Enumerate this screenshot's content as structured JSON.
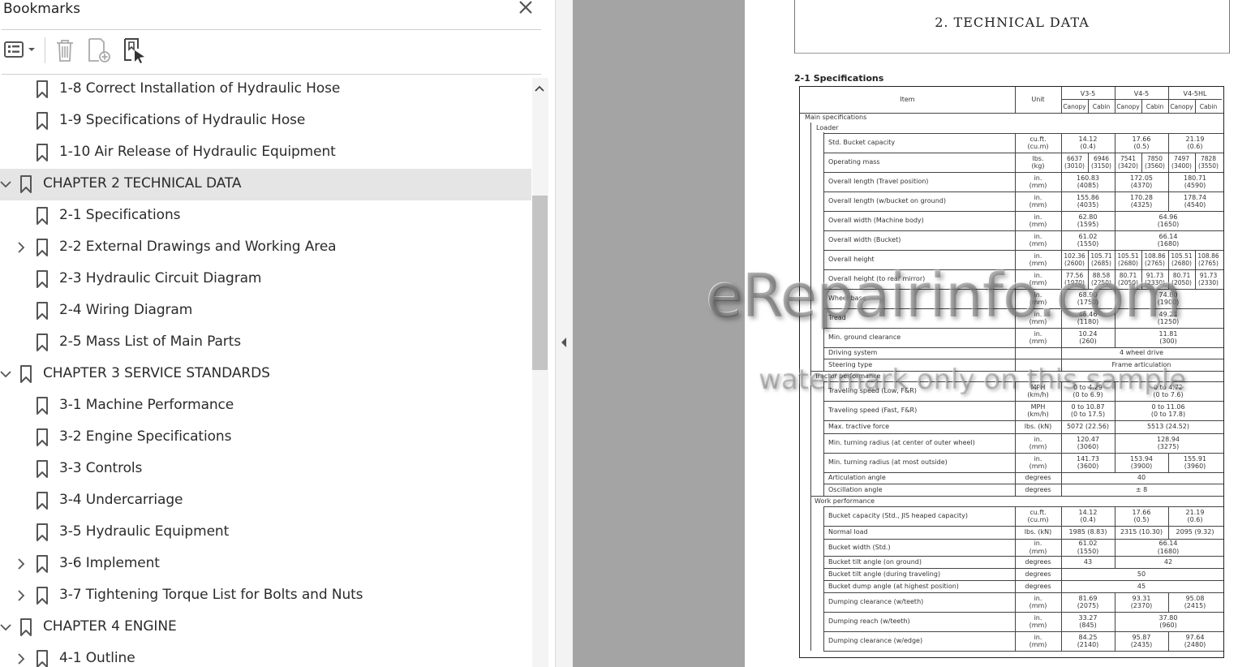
{
  "panel": {
    "title": "Bookmarks",
    "toolbar": {
      "options_icon": "list-options-icon",
      "delete_icon": "trash-icon",
      "new_bookmark_icon": "add-bookmark-icon",
      "find_bookmark_icon": "find-current-bookmark-icon"
    },
    "items": [
      {
        "label": "1-8 Correct Installation of Hydraulic Hose",
        "level": 2,
        "expander": "none",
        "selected": false
      },
      {
        "label": "1-9 Specifications of Hydraulic Hose",
        "level": 2,
        "expander": "none",
        "selected": false
      },
      {
        "label": "1-10 Air Release of Hydraulic Equipment",
        "level": 2,
        "expander": "none",
        "selected": false
      },
      {
        "label": "CHAPTER 2 TECHNICAL DATA",
        "level": 1,
        "expander": "expanded",
        "selected": true
      },
      {
        "label": "2-1 Specifications",
        "level": 2,
        "expander": "none",
        "selected": false
      },
      {
        "label": "2-2 External Drawings and Working Area",
        "level": 2,
        "expander": "collapsed",
        "selected": false
      },
      {
        "label": "2-3 Hydraulic Circuit Diagram",
        "level": 2,
        "expander": "none",
        "selected": false
      },
      {
        "label": "2-4 Wiring Diagram",
        "level": 2,
        "expander": "none",
        "selected": false
      },
      {
        "label": "2-5 Mass List of Main Parts",
        "level": 2,
        "expander": "none",
        "selected": false
      },
      {
        "label": "CHAPTER 3 SERVICE STANDARDS",
        "level": 1,
        "expander": "expanded",
        "selected": false
      },
      {
        "label": "3-1 Machine Performance",
        "level": 2,
        "expander": "none",
        "selected": false
      },
      {
        "label": "3-2 Engine Specifications",
        "level": 2,
        "expander": "none",
        "selected": false
      },
      {
        "label": "3-3 Controls",
        "level": 2,
        "expander": "none",
        "selected": false
      },
      {
        "label": "3-4 Undercarriage",
        "level": 2,
        "expander": "none",
        "selected": false
      },
      {
        "label": "3-5 Hydraulic Equipment",
        "level": 2,
        "expander": "none",
        "selected": false
      },
      {
        "label": "3-6 Implement",
        "level": 2,
        "expander": "collapsed",
        "selected": false
      },
      {
        "label": "3-7 Tightening Torque List for Bolts and Nuts",
        "level": 2,
        "expander": "collapsed",
        "selected": false
      },
      {
        "label": "CHAPTER 4 ENGINE",
        "level": 1,
        "expander": "expanded",
        "selected": false
      },
      {
        "label": "4-1 Outline",
        "level": 2,
        "expander": "collapsed",
        "selected": false
      }
    ]
  },
  "document": {
    "title": "2. TECHNICAL DATA",
    "section": "2-1 Specifications",
    "table": {
      "header": {
        "item": "Item",
        "unit": "Unit",
        "models": [
          "V3-5",
          "V4-5",
          "V4-5HL"
        ],
        "variants": [
          "Canopy",
          "Cabin",
          "Canopy",
          "Cabin",
          "Canopy",
          "Cabin"
        ]
      },
      "groups": {
        "main": "Main specifications",
        "loader": "Loader",
        "tractor": "Tractor performance",
        "work": "Work performance"
      },
      "rows": [
        {
          "item": "Std. Bucket capacity",
          "unit": [
            "cu.ft.",
            "(cu.m)"
          ],
          "vals": [
            [
              "14.12",
              "(0.4)"
            ],
            [
              "17.66",
              "(0.5)"
            ],
            [
              "21.19",
              "(0.6)"
            ]
          ]
        },
        {
          "item": "Operating mass",
          "unit": [
            "lbs.",
            "(kg)"
          ],
          "vals": [
            [
              "6637",
              "(3010)"
            ],
            [
              "6946",
              "(3150)"
            ],
            [
              "7541",
              "(3420)"
            ],
            [
              "7850",
              "(3560)"
            ],
            [
              "7497",
              "(3400)"
            ],
            [
              "7828",
              "(3550)"
            ]
          ]
        },
        {
          "item": "Overall length (Travel position)",
          "unit": [
            "in.",
            "(mm)"
          ],
          "vals": [
            [
              "160.83",
              "(4085)"
            ],
            [
              "172.05",
              "(4370)"
            ],
            [
              "180.71",
              "(4590)"
            ]
          ]
        },
        {
          "item": "Overall length (w/bucket on ground)",
          "unit": [
            "in.",
            "(mm)"
          ],
          "vals": [
            [
              "155.86",
              "(4035)"
            ],
            [
              "170.28",
              "(4325)"
            ],
            [
              "178.74",
              "(4540)"
            ]
          ]
        },
        {
          "item": "Overall width (Machine body)",
          "unit": [
            "in.",
            "(mm)"
          ],
          "vals": [
            [
              "62.80",
              "(1595)"
            ],
            [
              "64.96",
              "(1650)"
            ]
          ]
        },
        {
          "item": "Overall width (Bucket)",
          "unit": [
            "in.",
            "(mm)"
          ],
          "vals": [
            [
              "61.02",
              "(1550)"
            ],
            [
              "66.14",
              "(1680)"
            ]
          ]
        },
        {
          "item": "Overall height",
          "unit": [
            "in.",
            "(mm)"
          ],
          "vals": [
            [
              "102.36",
              "(2600)"
            ],
            [
              "105.71",
              "(2685)"
            ],
            [
              "105.51",
              "(2680)"
            ],
            [
              "108.86",
              "(2765)"
            ],
            [
              "105.51",
              "(2680)"
            ],
            [
              "108.86",
              "(2765)"
            ]
          ]
        },
        {
          "item": "Overall height (to rear mirror)",
          "unit": [
            "in.",
            "(mm)"
          ],
          "vals": [
            [
              "77.56",
              "(1970)"
            ],
            [
              "88.58",
              "(2250)"
            ],
            [
              "80.71",
              "(2050)"
            ],
            [
              "91.73",
              "(2330)"
            ],
            [
              "80.71",
              "(2050)"
            ],
            [
              "91.73",
              "(2330)"
            ]
          ]
        },
        {
          "item": "Wheel base",
          "unit": [
            "in.",
            "(mm)"
          ],
          "vals": [
            [
              "68.90",
              "(1750)"
            ],
            [
              "74.80",
              "(1900)"
            ]
          ]
        },
        {
          "item": "Tread",
          "unit": [
            "in.",
            "(mm)"
          ],
          "vals": [
            [
              "46.46",
              "(1180)"
            ],
            [
              "49.21",
              "(1250)"
            ]
          ]
        },
        {
          "item": "Min. ground clearance",
          "unit": [
            "in.",
            "(mm)"
          ],
          "vals": [
            [
              "10.24",
              "(260)"
            ],
            [
              "11.81",
              "(300)"
            ]
          ]
        },
        {
          "item": "Driving system",
          "unit": [
            ""
          ],
          "vals": [
            [
              "4 wheel drive"
            ]
          ]
        },
        {
          "item": "Steering type",
          "unit": [
            ""
          ],
          "vals": [
            [
              "Frame articulation"
            ]
          ]
        },
        {
          "item": "Traveling speed (Low, F&R)",
          "unit": [
            "MPH",
            "(km/h)"
          ],
          "vals": [
            [
              "0 to 4.29",
              "(0 to 6.9)"
            ],
            [
              "0 to 4.72",
              "(0 to 7.6)"
            ]
          ]
        },
        {
          "item": "Traveling speed (Fast, F&R)",
          "unit": [
            "MPH",
            "(km/h)"
          ],
          "vals": [
            [
              "0 to 10.87",
              "(0 to 17.5)"
            ],
            [
              "0 to 11.06",
              "(0 to 17.8)"
            ]
          ]
        },
        {
          "item": "Max. tractive force",
          "unit": [
            "lbs. (kN)"
          ],
          "vals": [
            [
              "5072 (22.56)"
            ],
            [
              "5513 (24.52)"
            ]
          ]
        },
        {
          "item": "Min. turning radius (at center of outer wheel)",
          "unit": [
            "in.",
            "(mm)"
          ],
          "vals": [
            [
              "120.47",
              "(3060)"
            ],
            [
              "128.94",
              "(3275)"
            ]
          ]
        },
        {
          "item": "Min. turning radius (at most outside)",
          "unit": [
            "in.",
            "(mm)"
          ],
          "vals": [
            [
              "141.73",
              "(3600)"
            ],
            [
              "153.94",
              "(3900)"
            ],
            [
              "155.91",
              "(3960)"
            ]
          ]
        },
        {
          "item": "Articulation angle",
          "unit": [
            "degrees"
          ],
          "vals": [
            [
              "40"
            ]
          ]
        },
        {
          "item": "Oscillation angle",
          "unit": [
            "degrees"
          ],
          "vals": [
            [
              "± 8"
            ]
          ]
        },
        {
          "item": "Bucket capacity (Std., JIS heaped capacity)",
          "unit": [
            "cu.ft.",
            "(cu.m)"
          ],
          "vals": [
            [
              "14.12",
              "(0.4)"
            ],
            [
              "17.66",
              "(0.5)"
            ],
            [
              "21.19",
              "(0.6)"
            ]
          ]
        },
        {
          "item": "Normal load",
          "unit": [
            "lbs. (kN)"
          ],
          "vals": [
            [
              "1985 (8.83)"
            ],
            [
              "2315 (10.30)"
            ],
            [
              "2095 (9.32)"
            ]
          ]
        },
        {
          "item": "Bucket width (Std.)",
          "unit": [
            "in.",
            "(mm)"
          ],
          "vals": [
            [
              "61.02",
              "(1550)"
            ],
            [
              "66.14",
              "(1680)"
            ]
          ]
        },
        {
          "item": "Bucket tilt angle (on ground)",
          "unit": [
            "degrees"
          ],
          "vals": [
            [
              "43"
            ],
            [
              "42"
            ]
          ]
        },
        {
          "item": "Bucket tilt angle (during traveling)",
          "unit": [
            "degrees"
          ],
          "vals": [
            [
              "50"
            ]
          ]
        },
        {
          "item": "Bucket dump angle (at highest position)",
          "unit": [
            "degrees"
          ],
          "vals": [
            [
              "45"
            ]
          ]
        },
        {
          "item": "Dumping clearance (w/teeth)",
          "unit": [
            "in.",
            "(mm)"
          ],
          "vals": [
            [
              "81.69",
              "(2075)"
            ],
            [
              "93.31",
              "(2370)"
            ],
            [
              "95.08",
              "(2415)"
            ]
          ]
        },
        {
          "item": "Dumping reach (w/teeth)",
          "unit": [
            "in.",
            "(mm)"
          ],
          "vals": [
            [
              "33.27",
              "(845)"
            ],
            [
              "37.80",
              "(960)"
            ]
          ]
        },
        {
          "item": "Dumping clearance (w/edge)",
          "unit": [
            "in.",
            "(mm)"
          ],
          "vals": [
            [
              "84.25",
              "(2140)"
            ],
            [
              "95.87",
              "(2435)"
            ],
            [
              "97.64",
              "(2480)"
            ]
          ]
        }
      ]
    }
  },
  "watermark": {
    "line1": "eRepairinfo.com",
    "line2": "watermark only on this sample"
  }
}
